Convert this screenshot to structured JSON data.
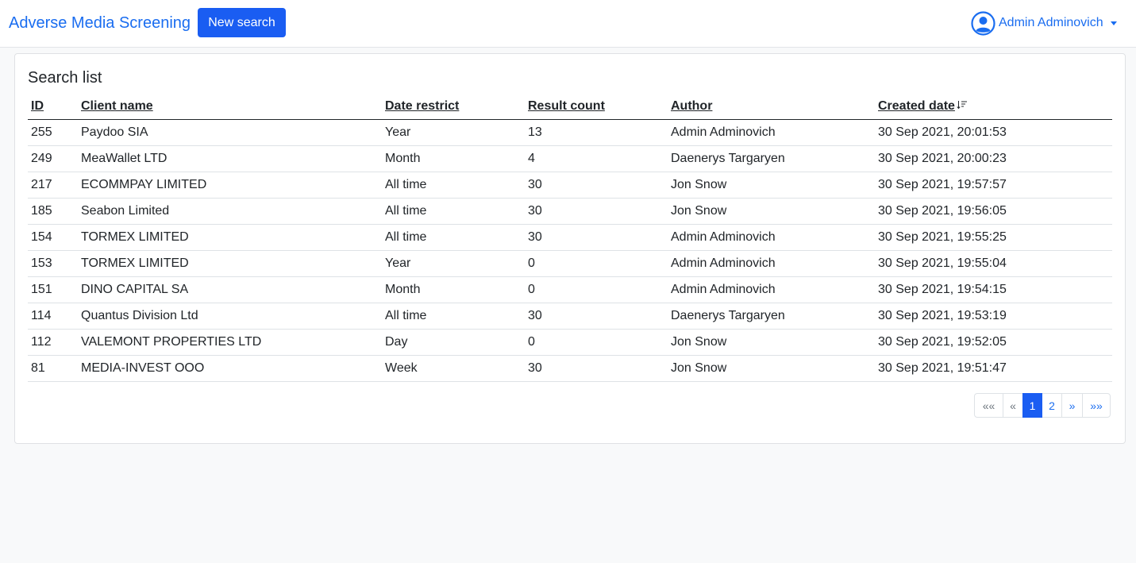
{
  "navbar": {
    "brand": "Adverse Media Screening",
    "new_search_label": "New search",
    "user_name": "Admin Adminovich"
  },
  "card": {
    "title": "Search list"
  },
  "table": {
    "headers": {
      "id": "ID",
      "client": "Client name",
      "date_restrict": "Date restrict",
      "result_count": "Result count",
      "author": "Author",
      "created": "Created date"
    },
    "sort_icon": "sort-descending-icon",
    "rows": [
      {
        "id": "255",
        "client": "Paydoo SIA",
        "date_restrict": "Year",
        "result_count": "13",
        "author": "Admin Adminovich",
        "created": "30 Sep 2021, 20:01:53"
      },
      {
        "id": "249",
        "client": "MeaWallet LTD",
        "date_restrict": "Month",
        "result_count": "4",
        "author": "Daenerys Targaryen",
        "created": "30 Sep 2021, 20:00:23"
      },
      {
        "id": "217",
        "client": "ECOMMPAY LIMITED",
        "date_restrict": "All time",
        "result_count": "30",
        "author": "Jon Snow",
        "created": "30 Sep 2021, 19:57:57"
      },
      {
        "id": "185",
        "client": "Seabon Limited",
        "date_restrict": "All time",
        "result_count": "30",
        "author": "Jon Snow",
        "created": "30 Sep 2021, 19:56:05"
      },
      {
        "id": "154",
        "client": "TORMEX LIMITED",
        "date_restrict": "All time",
        "result_count": "30",
        "author": "Admin Adminovich",
        "created": "30 Sep 2021, 19:55:25"
      },
      {
        "id": "153",
        "client": "TORMEX LIMITED",
        "date_restrict": "Year",
        "result_count": "0",
        "author": "Admin Adminovich",
        "created": "30 Sep 2021, 19:55:04"
      },
      {
        "id": "151",
        "client": "DINO CAPITAL SA",
        "date_restrict": "Month",
        "result_count": "0",
        "author": "Admin Adminovich",
        "created": "30 Sep 2021, 19:54:15"
      },
      {
        "id": "114",
        "client": "Quantus Division Ltd",
        "date_restrict": "All time",
        "result_count": "30",
        "author": "Daenerys Targaryen",
        "created": "30 Sep 2021, 19:53:19"
      },
      {
        "id": "112",
        "client": "VALEMONT PROPERTIES LTD",
        "date_restrict": "Day",
        "result_count": "0",
        "author": "Jon Snow",
        "created": "30 Sep 2021, 19:52:05"
      },
      {
        "id": "81",
        "client": "MEDIA-INVEST OOO",
        "date_restrict": "Week",
        "result_count": "30",
        "author": "Jon Snow",
        "created": "30 Sep 2021, 19:51:47"
      }
    ]
  },
  "pagination": {
    "first": "««",
    "prev": "«",
    "pages": [
      "1",
      "2"
    ],
    "current": "1",
    "next": "»",
    "last": "»»"
  },
  "colors": {
    "accent": "#1a5df2",
    "link": "#1a6df0",
    "background": "#f8f9fa"
  }
}
